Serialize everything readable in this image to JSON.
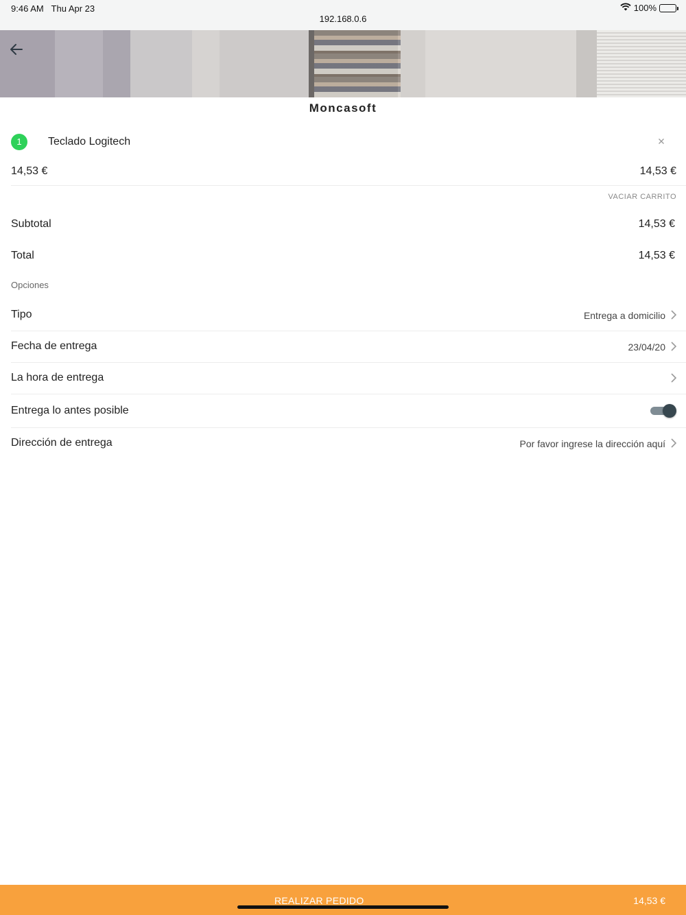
{
  "status_bar": {
    "time": "9:46 AM",
    "date": "Thu Apr 23",
    "url": "192.168.0.6",
    "battery": "100%"
  },
  "header": {
    "shop_name": "Moncasoft"
  },
  "cart": {
    "items": [
      {
        "quantity": "1",
        "name": "Teclado Logitech",
        "unit_price": "14,53 €",
        "line_total": "14,53 €"
      }
    ],
    "clear_label": "VACIAR CARRITO"
  },
  "summary": {
    "subtotal_label": "Subtotal",
    "subtotal_value": "14,53 €",
    "total_label": "Total",
    "total_value": "14,53 €"
  },
  "options": {
    "heading": "Opciones",
    "rows": [
      {
        "label": "Tipo",
        "value": "Entrega a domicilio"
      },
      {
        "label": "Fecha de entrega",
        "value": "23/04/20"
      },
      {
        "label": "La hora de entrega",
        "value": ""
      },
      {
        "label": "Entrega lo antes posible",
        "toggle_on": true
      },
      {
        "label": "Dirección de entrega",
        "value": "Por favor ingrese la dirección aquí"
      }
    ]
  },
  "footer": {
    "order_label": "REALIZAR PEDIDO",
    "order_total": "14,53 €",
    "accent_color": "#f8a13d"
  },
  "icons": {
    "back": "arrow-left-icon",
    "remove": "close-icon",
    "chevron": "chevron-right-icon",
    "wifi": "wifi-icon",
    "battery": "battery-icon"
  }
}
